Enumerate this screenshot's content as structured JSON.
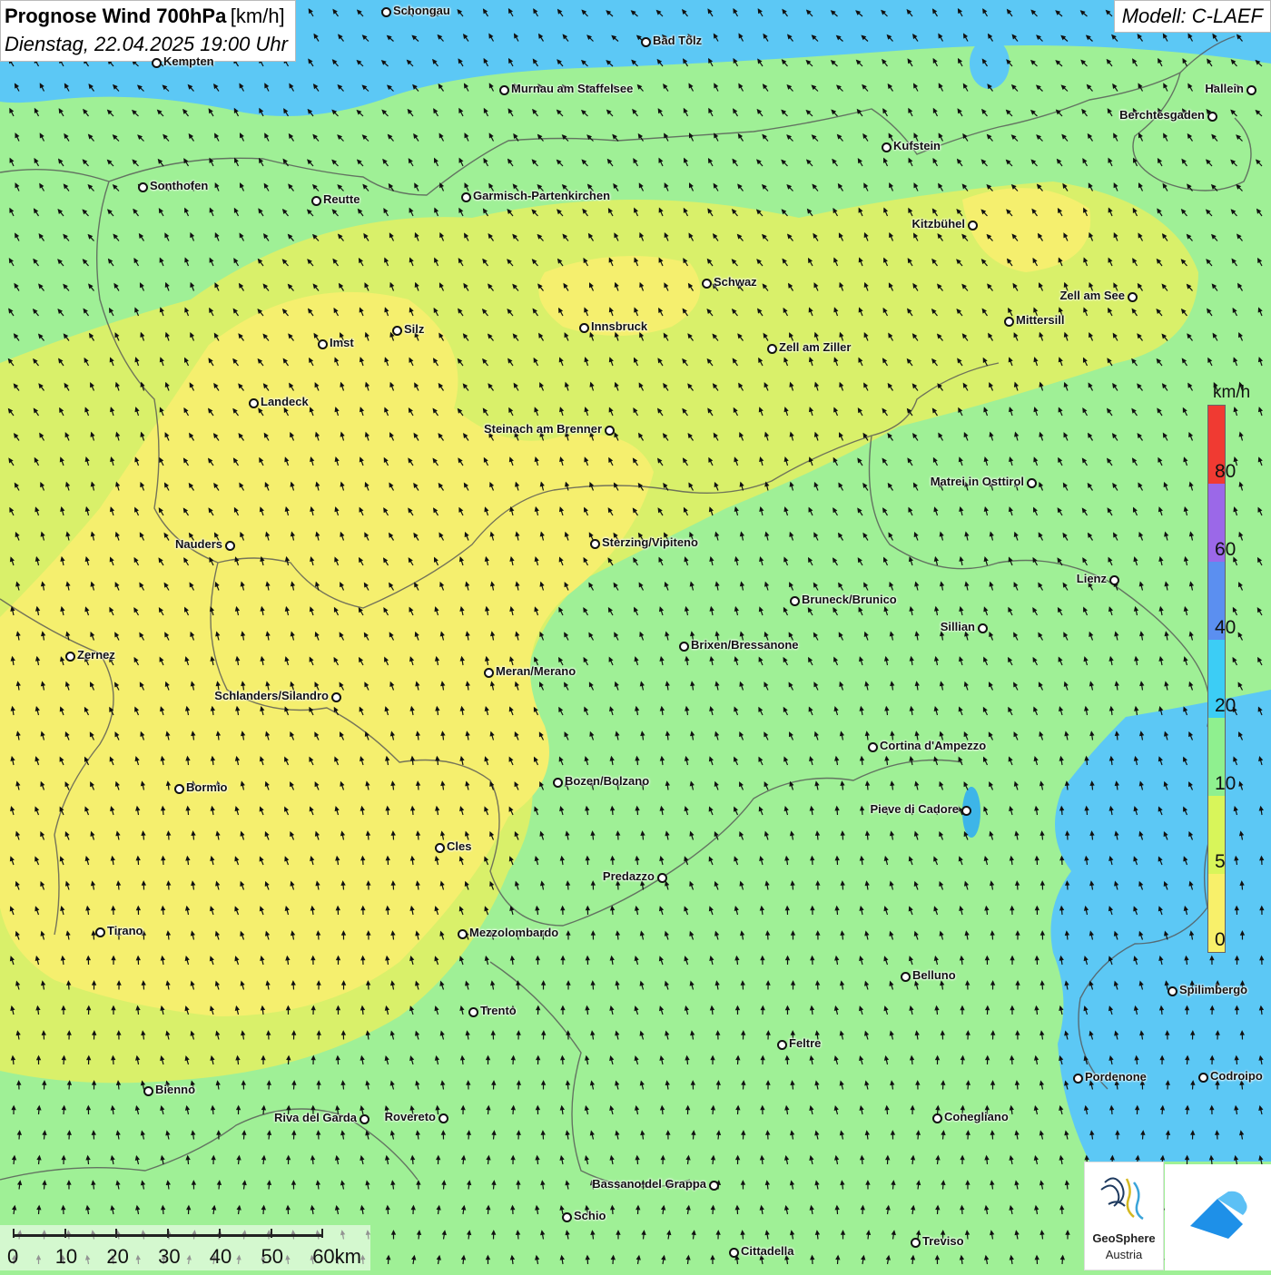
{
  "title": {
    "main": "Prognose Wind 700hPa",
    "unit": "[km/h]",
    "date": "Dienstag, 22.04.2025 19:00 Uhr"
  },
  "model": "Modell: C-LAEF",
  "legend": {
    "unit": "km/h",
    "colors": [
      "#f03a32",
      "#9b68e8",
      "#5b8ff0",
      "#3ccdf5",
      "#8ff08f",
      "#d8f55a",
      "#f8f06a"
    ],
    "ticks": [
      "80",
      "60",
      "40",
      "20",
      "10",
      "5",
      "0"
    ]
  },
  "scale": {
    "labels": [
      "0",
      "10",
      "20",
      "30",
      "40",
      "50",
      "60km"
    ]
  },
  "logo": {
    "name_line1": "GeoSphere",
    "name_line2": "Austria"
  },
  "colors": {
    "yellow": "#f5ef6e",
    "lightgreen": "#d9f06a",
    "green": "#9ff096",
    "blue": "#5cc8f5",
    "border": "#555555"
  },
  "cities": [
    {
      "id": "schongau",
      "name": "Schongau"
    },
    {
      "id": "bad-toelz",
      "name": "Bad Tölz"
    },
    {
      "id": "kempten",
      "name": "Kempten"
    },
    {
      "id": "murnau",
      "name": "Murnau am Staffelsee"
    },
    {
      "id": "hallein",
      "name": "Hallein"
    },
    {
      "id": "berchtesgaden",
      "name": "Berchtesgaden"
    },
    {
      "id": "kufstein",
      "name": "Kufstein"
    },
    {
      "id": "sonthofen",
      "name": "Sonthofen"
    },
    {
      "id": "reutte",
      "name": "Reutte"
    },
    {
      "id": "garmisch",
      "name": "Garmisch-Partenkirchen"
    },
    {
      "id": "kitzbuehel",
      "name": "Kitzbühel"
    },
    {
      "id": "schwaz",
      "name": "Schwaz"
    },
    {
      "id": "zell-am-see",
      "name": "Zell am See"
    },
    {
      "id": "mittersill",
      "name": "Mittersill"
    },
    {
      "id": "innsbruck",
      "name": "Innsbruck"
    },
    {
      "id": "silz",
      "name": "Silz"
    },
    {
      "id": "imst",
      "name": "Imst"
    },
    {
      "id": "zell-am-ziller",
      "name": "Zell am Ziller"
    },
    {
      "id": "landeck",
      "name": "Landeck"
    },
    {
      "id": "steinach",
      "name": "Steinach am Brenner"
    },
    {
      "id": "matrei",
      "name": "Matrei in Osttirol"
    },
    {
      "id": "nauders",
      "name": "Nauders"
    },
    {
      "id": "sterzing",
      "name": "Sterzing/Vipiteno"
    },
    {
      "id": "lienz",
      "name": "Lienz"
    },
    {
      "id": "bruneck",
      "name": "Bruneck/Brunico"
    },
    {
      "id": "sillian",
      "name": "Sillian"
    },
    {
      "id": "brixen",
      "name": "Brixen/Bressanone"
    },
    {
      "id": "zernez",
      "name": "Zernez"
    },
    {
      "id": "meran",
      "name": "Meran/Merano"
    },
    {
      "id": "schlanders",
      "name": "Schlanders/Silandro"
    },
    {
      "id": "cortina",
      "name": "Cortina d'Ampezzo"
    },
    {
      "id": "bozen",
      "name": "Bozen/Bolzano"
    },
    {
      "id": "bormio",
      "name": "Bormio"
    },
    {
      "id": "pieve",
      "name": "Pieve di Cadore"
    },
    {
      "id": "cles",
      "name": "Cles"
    },
    {
      "id": "predazzo",
      "name": "Predazzo"
    },
    {
      "id": "tirano",
      "name": "Tirano"
    },
    {
      "id": "mezzolombardo",
      "name": "Mezzolombardo"
    },
    {
      "id": "belluno",
      "name": "Belluno"
    },
    {
      "id": "spilimbergo",
      "name": "Spilimbergo"
    },
    {
      "id": "trento",
      "name": "Trento"
    },
    {
      "id": "feltre",
      "name": "Feltre"
    },
    {
      "id": "pordenone",
      "name": "Pordenone"
    },
    {
      "id": "codroipo",
      "name": "Codroipo"
    },
    {
      "id": "bienno",
      "name": "Bienno"
    },
    {
      "id": "riva",
      "name": "Riva del Garda"
    },
    {
      "id": "rovereto",
      "name": "Rovereto"
    },
    {
      "id": "conegliano",
      "name": "Conegliano"
    },
    {
      "id": "bassano",
      "name": "Bassano del Grappa"
    },
    {
      "id": "schio",
      "name": "Schio"
    },
    {
      "id": "treviso",
      "name": "Treviso"
    },
    {
      "id": "cittadella",
      "name": "Cittadella"
    }
  ]
}
